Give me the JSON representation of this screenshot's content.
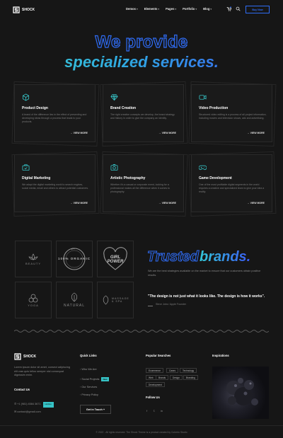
{
  "header": {
    "logo_text": "SHOCK",
    "nav": [
      "Demos",
      "Elements",
      "Pages",
      "Portfolio",
      "Blog"
    ],
    "buy_label": "Buy Now"
  },
  "hero": {
    "line1": "We provide",
    "line2": "specialized services."
  },
  "services": [
    {
      "title": "Product Design",
      "icon": "cube-icon",
      "desc": "A brand of the difference lies in the effect of presenting and developing ideas through a process that leads to your products.",
      "more": "VIEW MORE"
    },
    {
      "title": "Brand Creation",
      "icon": "diamond-icon",
      "desc": "The right creative concepts we develop, the brand strategy and history in order to give the company an identity.",
      "more": "VIEW MORE"
    },
    {
      "title": "Video Production",
      "icon": "video-camera-icon",
      "desc": "Structured video editing is a process of all project information, including movies and television shows, ads and advertising.",
      "more": "VIEW MORE"
    },
    {
      "title": "Digital Marketing",
      "icon": "briefcase-icon",
      "desc": "We adapt the digital marketing world to search engines, social media, email and others to attract potential customers.",
      "more": "VIEW MORE"
    },
    {
      "title": "Artistic Photography",
      "icon": "camera-icon",
      "desc": "Whether it's a casual or corporate event, looking for a professional makes all the difference when it comes to photography.",
      "more": "VIEW MORE"
    },
    {
      "title": "Game Development",
      "icon": "gamepad-icon",
      "desc": "One of the most profitable digital segments in the world requires a creative and specialized team to give your idea a reality.",
      "more": "VIEW MORE"
    }
  ],
  "brands": {
    "title_outline": "Trusted",
    "title_fill": "brands.",
    "desc": "We are the best strategies available on the market to ensure that our customers obtain positive results.",
    "quote": "\"The design is not just what it looks like. The design is how it works\".",
    "quote_author": "Steve Jobs / Apple Founder",
    "logos": [
      "BEAUTY",
      "100% ORGANIC",
      "GIRL POWER",
      "YOGA",
      "NATURAL",
      "MASSAGE & SPA"
    ]
  },
  "footer": {
    "logo_text": "SHOCK",
    "about": "Lorem ipsum dolor sit amet, consect adipiscing elit cras quis tellus semper nisl consequat dignissim enim.",
    "contact_heading": "Contact Us",
    "phone": "+1 (981) 4584 3671",
    "phone_badge": "Hotline",
    "email": "contact@gmail.com",
    "quick_links_heading": "Quick Links",
    "quick_links": [
      "Who We Are",
      "Social Projects",
      "Our Services",
      "Privacy Policy"
    ],
    "new_badge": "New",
    "get_in_touch": "Get in Touch",
    "popular_heading": "Popular Searches",
    "tags": [
      "Ecommerce",
      "Cases",
      "Technology",
      "Web",
      "Brands",
      "Design",
      "Branding",
      "Development"
    ],
    "follow_heading": "Follow Us",
    "inspirations_heading": "Inspirations",
    "copyright": "© 2022 - All rights reserved. The Shock Theme is a product created by Cuberto Studio"
  },
  "colors": {
    "accent_blue": "#2f6cf5",
    "accent_teal": "#36c3c6",
    "background": "#161616"
  }
}
